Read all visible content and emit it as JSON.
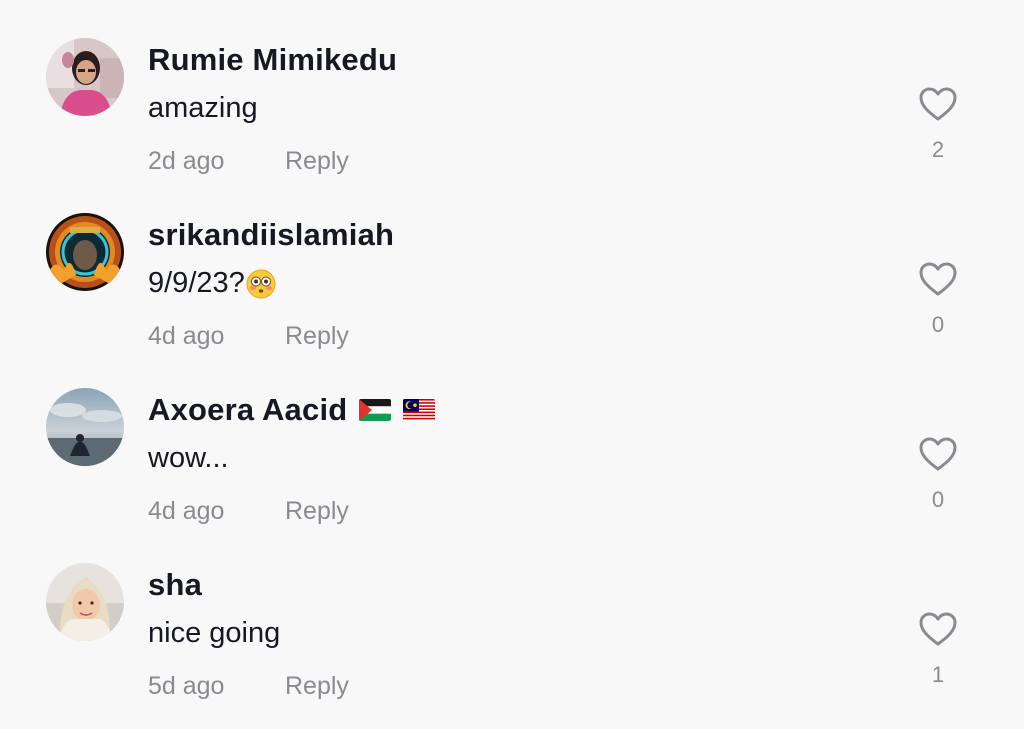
{
  "comments": [
    {
      "username": "Rumie Mimikedu",
      "text": "amazing",
      "time": "2d ago",
      "reply": "Reply",
      "likes": "2"
    },
    {
      "username": "srikandiislamiah",
      "text": "9/9/23?",
      "emoji": "flushed-face",
      "time": "4d ago",
      "reply": "Reply",
      "likes": "0"
    },
    {
      "username": "Axoera Aacid",
      "flags": [
        "palestine-flag",
        "malaysia-flag"
      ],
      "text": "wow...",
      "time": "4d ago",
      "reply": "Reply",
      "likes": "0"
    },
    {
      "username": "sha",
      "text": "nice going",
      "time": "5d ago",
      "reply": "Reply",
      "likes": "1"
    }
  ],
  "icons": {
    "like": "heart-outline-icon"
  },
  "colors": {
    "background": "#f8f8f8",
    "username": "#161823",
    "secondary_text": "#8a8b91",
    "icon": "#8a8b91"
  }
}
